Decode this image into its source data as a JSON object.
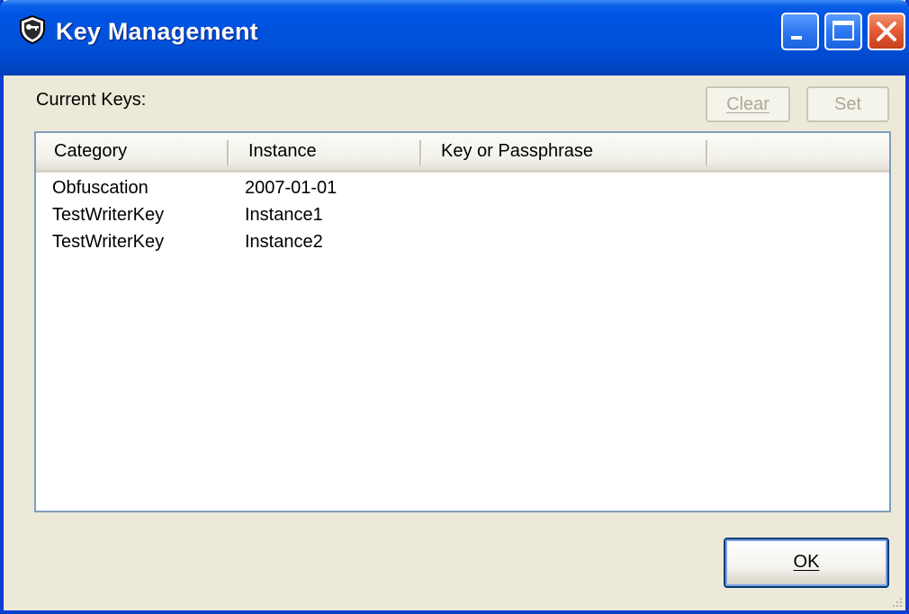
{
  "window": {
    "title": "Key Management",
    "icon": "shield-key-icon",
    "controls": [
      "minimize-icon",
      "maximize-icon",
      "close-icon"
    ],
    "accent": "#0054e3"
  },
  "dialog": {
    "current_keys_label": "Current Keys:",
    "clear_label": "Clear",
    "set_label": "Set",
    "ok_label": "OK"
  },
  "table": {
    "columns": [
      "Category",
      "Instance",
      "Key or Passphrase",
      ""
    ],
    "rows": [
      {
        "category": "Obfuscation",
        "instance": "2007-01-01",
        "key": ""
      },
      {
        "category": "TestWriterKey",
        "instance": "Instance1",
        "key": ""
      },
      {
        "category": "TestWriterKey",
        "instance": "Instance2",
        "key": ""
      }
    ]
  }
}
